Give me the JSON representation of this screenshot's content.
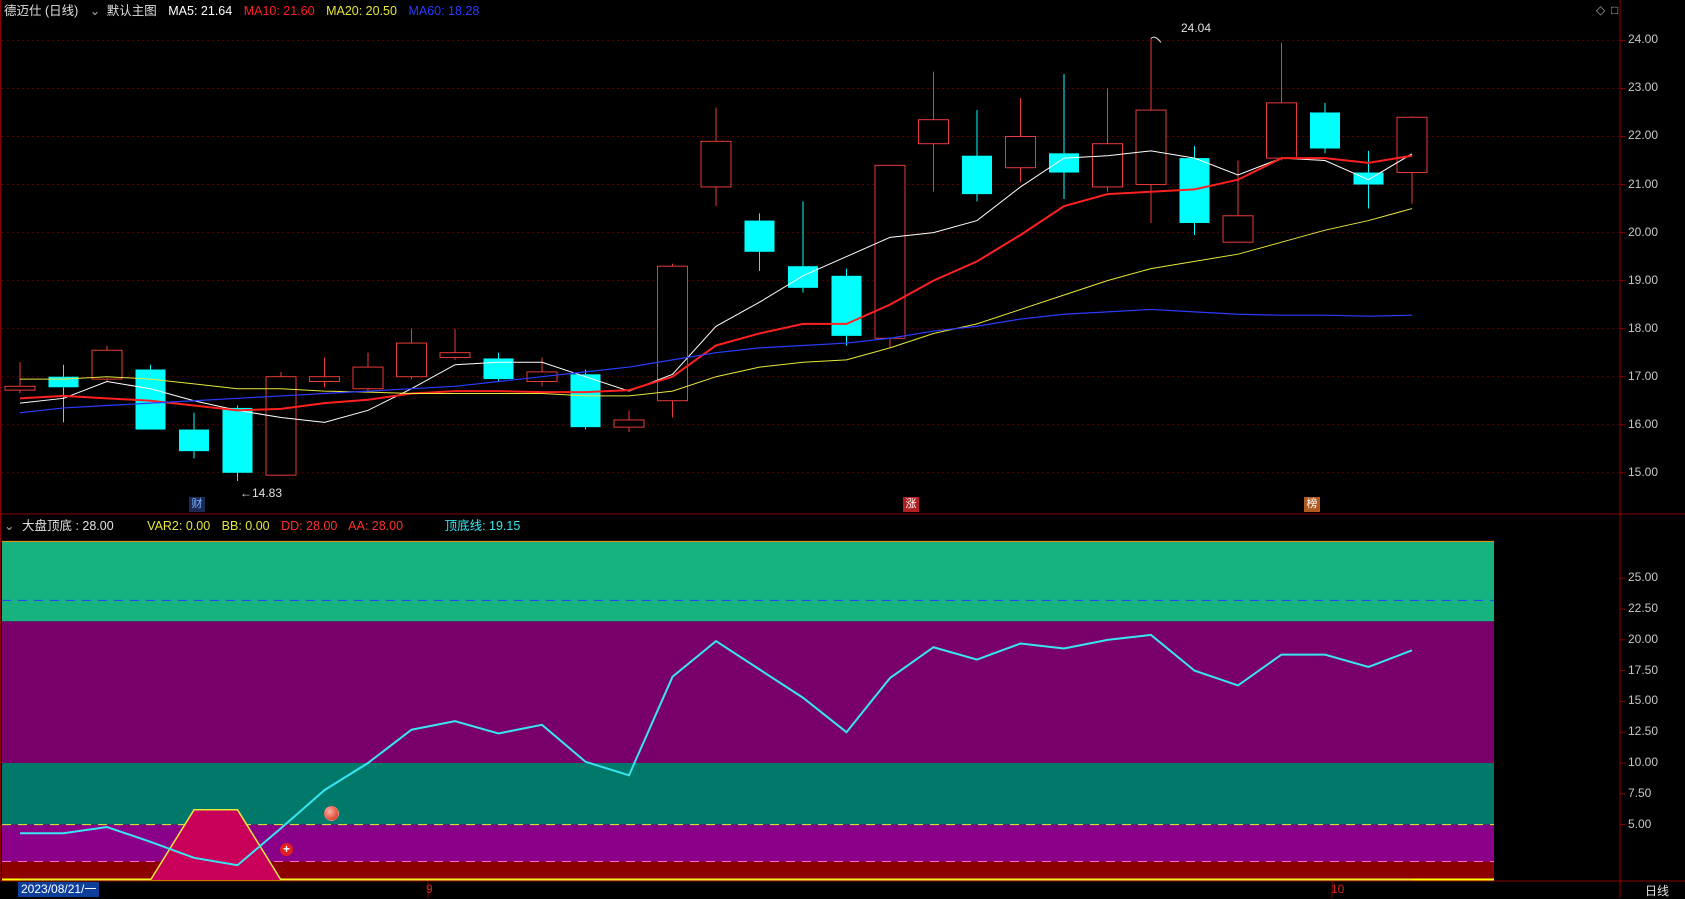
{
  "window": {
    "stock_title": "德迈仕 (日线)",
    "main_template": "默认主图",
    "panel_icons": [
      "diamond-icon",
      "square-icon"
    ],
    "cycle_label": "日线"
  },
  "main_legend": [
    {
      "label": "MA5: 21.64",
      "color": "#ffffff"
    },
    {
      "label": "MA10: 21.60",
      "color": "#ff2020"
    },
    {
      "label": "MA20: 20.50",
      "color": "#e8e83a"
    },
    {
      "label": "MA60: 18.28",
      "color": "#2a3cff"
    }
  ],
  "sub_legend": [
    {
      "label": "大盘顶底 : 28.00",
      "color": "#e0e0e0"
    },
    {
      "label": "VAR2: 0.00",
      "color": "#e8e83a"
    },
    {
      "label": "BB: 0.00",
      "color": "#e8e83a"
    },
    {
      "label": "DD: 28.00",
      "color": "#ff3030"
    },
    {
      "label": "AA: 28.00",
      "color": "#ff3030"
    },
    {
      "label": "顶底线: 19.15",
      "color": "#38e6f2"
    }
  ],
  "x_axis": {
    "labels": [
      "2023/08/21/一",
      "9",
      "10"
    ]
  },
  "annotations": {
    "high_label": "24.04",
    "low_label": "←14.83",
    "events": [
      "财",
      "涨",
      "榜"
    ]
  },
  "chart_data": [
    {
      "type": "candlestick",
      "ylim": [
        14.6,
        24.3
      ],
      "y_ticks": [
        "24.00",
        "23.00",
        "22.00",
        "21.00",
        "20.00",
        "19.00",
        "18.00",
        "17.00",
        "16.00",
        "15.00"
      ],
      "candles": [
        {
          "o": 16.72,
          "c": 16.8,
          "h": 17.3,
          "l": 16.65
        },
        {
          "o": 17.0,
          "c": 16.78,
          "h": 17.25,
          "l": 16.05
        },
        {
          "o": 16.95,
          "c": 17.55,
          "h": 17.65,
          "l": 16.9
        },
        {
          "o": 17.15,
          "c": 15.9,
          "h": 17.25,
          "l": 15.9
        },
        {
          "o": 15.9,
          "c": 15.45,
          "h": 16.25,
          "l": 15.3
        },
        {
          "o": 16.35,
          "c": 15.0,
          "h": 16.4,
          "l": 14.83
        },
        {
          "o": 14.95,
          "c": 17.0,
          "h": 17.1,
          "l": 14.95
        },
        {
          "o": 16.9,
          "c": 17.0,
          "h": 17.4,
          "l": 16.78
        },
        {
          "o": 16.75,
          "c": 17.2,
          "h": 17.5,
          "l": 16.7
        },
        {
          "o": 17.0,
          "c": 17.7,
          "h": 18.0,
          "l": 16.95
        },
        {
          "o": 17.4,
          "c": 17.5,
          "h": 18.0,
          "l": 17.35
        },
        {
          "o": 17.38,
          "c": 16.95,
          "h": 17.5,
          "l": 16.9
        },
        {
          "o": 16.9,
          "c": 17.1,
          "h": 17.4,
          "l": 16.8
        },
        {
          "o": 17.05,
          "c": 15.95,
          "h": 17.15,
          "l": 15.9
        },
        {
          "o": 15.95,
          "c": 16.1,
          "h": 16.3,
          "l": 15.85
        },
        {
          "o": 16.5,
          "c": 19.3,
          "h": 19.35,
          "l": 16.15
        },
        {
          "o": 20.95,
          "c": 21.9,
          "h": 22.6,
          "l": 20.55
        },
        {
          "o": 20.25,
          "c": 19.6,
          "h": 20.4,
          "l": 19.2
        },
        {
          "o": 19.3,
          "c": 18.85,
          "h": 20.65,
          "l": 18.75
        },
        {
          "o": 19.1,
          "c": 17.85,
          "h": 19.25,
          "l": 17.65
        },
        {
          "o": 17.8,
          "c": 21.4,
          "h": 21.4,
          "l": 17.6
        },
        {
          "o": 21.85,
          "c": 22.35,
          "h": 23.35,
          "l": 20.85
        },
        {
          "o": 21.6,
          "c": 20.8,
          "h": 22.55,
          "l": 20.65
        },
        {
          "o": 21.35,
          "c": 22.0,
          "h": 22.8,
          "l": 21.05
        },
        {
          "o": 21.65,
          "c": 21.25,
          "h": 23.3,
          "l": 20.7
        },
        {
          "o": 20.95,
          "c": 21.85,
          "h": 23.0,
          "l": 20.85
        },
        {
          "o": 21.0,
          "c": 22.55,
          "h": 24.04,
          "l": 20.2
        },
        {
          "o": 21.55,
          "c": 20.2,
          "h": 21.8,
          "l": 19.95
        },
        {
          "o": 19.8,
          "c": 20.35,
          "h": 21.5,
          "l": 19.8
        },
        {
          "o": 21.55,
          "c": 22.7,
          "h": 23.95,
          "l": 21.5
        },
        {
          "o": 22.5,
          "c": 21.75,
          "h": 22.7,
          "l": 21.65
        },
        {
          "o": 21.25,
          "c": 21.0,
          "h": 21.7,
          "l": 20.5
        },
        {
          "o": 21.25,
          "c": 22.4,
          "h": 22.42,
          "l": 20.6
        }
      ],
      "series": [
        {
          "name": "MA5",
          "color": "#ffffff",
          "values": [
            16.45,
            16.55,
            16.9,
            16.75,
            16.5,
            16.3,
            16.15,
            16.05,
            16.3,
            16.75,
            17.25,
            17.3,
            17.3,
            17.0,
            16.7,
            17.05,
            18.05,
            18.55,
            19.1,
            19.5,
            19.9,
            20.0,
            20.25,
            20.95,
            21.55,
            21.6,
            21.7,
            21.55,
            21.2,
            21.55,
            21.5,
            21.1,
            21.64
          ]
        },
        {
          "name": "MA10",
          "color": "#ff2020",
          "values": [
            16.55,
            16.6,
            16.55,
            16.5,
            16.4,
            16.3,
            16.33,
            16.45,
            16.52,
            16.65,
            16.7,
            16.7,
            16.68,
            16.68,
            16.72,
            17.0,
            17.65,
            17.9,
            18.1,
            18.1,
            18.5,
            19.0,
            19.4,
            19.95,
            20.55,
            20.8,
            20.85,
            20.9,
            21.1,
            21.55,
            21.55,
            21.45,
            21.6
          ]
        },
        {
          "name": "MA20",
          "color": "#e8e83a",
          "values": [
            16.95,
            16.95,
            17.0,
            16.95,
            16.85,
            16.75,
            16.75,
            16.7,
            16.68,
            16.65,
            16.65,
            16.65,
            16.65,
            16.6,
            16.6,
            16.7,
            17.0,
            17.2,
            17.3,
            17.35,
            17.6,
            17.9,
            18.1,
            18.4,
            18.7,
            19.0,
            19.25,
            19.4,
            19.55,
            19.8,
            20.05,
            20.25,
            20.5
          ]
        },
        {
          "name": "MA60",
          "color": "#2a3cff",
          "values": [
            16.25,
            16.35,
            16.4,
            16.45,
            16.5,
            16.55,
            16.6,
            16.65,
            16.7,
            16.75,
            16.8,
            16.9,
            17.0,
            17.1,
            17.2,
            17.35,
            17.5,
            17.6,
            17.65,
            17.7,
            17.8,
            17.95,
            18.05,
            18.2,
            18.3,
            18.35,
            18.4,
            18.35,
            18.3,
            18.28,
            18.28,
            18.26,
            18.28
          ]
        }
      ]
    },
    {
      "type": "line",
      "ylim": [
        0.5,
        29.0
      ],
      "y_ticks": [
        "25.00",
        "22.50",
        "20.00",
        "17.50",
        "15.00",
        "12.50",
        "10.00",
        "7.50",
        "5.00"
      ],
      "y_tick_values": [
        25,
        22.5,
        20,
        17.5,
        15,
        12.5,
        10,
        7.5,
        5
      ],
      "bands": [
        {
          "from": 21.5,
          "to": 28.0,
          "color": "#16b380"
        },
        {
          "from": 10.0,
          "to": 21.5,
          "color": "#780068"
        },
        {
          "from": 5.0,
          "to": 10.0,
          "color": "#00786a"
        },
        {
          "from": 2.0,
          "to": 5.0,
          "color": "#8a0088"
        },
        {
          "from": 0.5,
          "to": 2.0,
          "color": "#8c0000"
        }
      ],
      "ref_lines": [
        {
          "value": 28.0,
          "color": "#ff8c00",
          "dash": false
        },
        {
          "value": 23.2,
          "color": "#2a3cff",
          "dash": true
        },
        {
          "value": 5.0,
          "color": "#e8e83a",
          "dash": true
        },
        {
          "value": 2.0,
          "color": "#ff66dd",
          "dash": true
        },
        {
          "value": 0.5,
          "color": "#ffff00",
          "dash": false
        }
      ],
      "series": [
        {
          "name": "顶底线",
          "color": "#38e6f2",
          "values": [
            4.3,
            4.3,
            4.8,
            3.6,
            2.3,
            1.7,
            4.7,
            7.8,
            10.0,
            12.7,
            13.4,
            12.4,
            13.1,
            10.1,
            9.0,
            17.0,
            19.9,
            17.6,
            15.3,
            12.5,
            16.9,
            19.4,
            18.4,
            19.7,
            19.3,
            20.0,
            20.4,
            17.5,
            16.3,
            18.8,
            18.8,
            17.8,
            19.15
          ]
        },
        {
          "name": "VAR2",
          "color": "#e8e83a",
          "values": [
            0.5,
            0.5,
            0.5,
            0.5,
            6.2,
            6.2,
            0.5,
            0.5,
            0.5,
            0.5,
            0.5,
            0.5,
            0.5,
            0.5,
            0.5,
            0.5,
            0.5,
            0.5,
            0.5,
            0.5,
            0.5,
            0.5,
            0.5,
            0.5,
            0.5,
            0.5,
            0.5,
            0.5,
            0.5,
            0.5,
            0.5,
            0.5,
            0.5
          ]
        }
      ]
    }
  ]
}
